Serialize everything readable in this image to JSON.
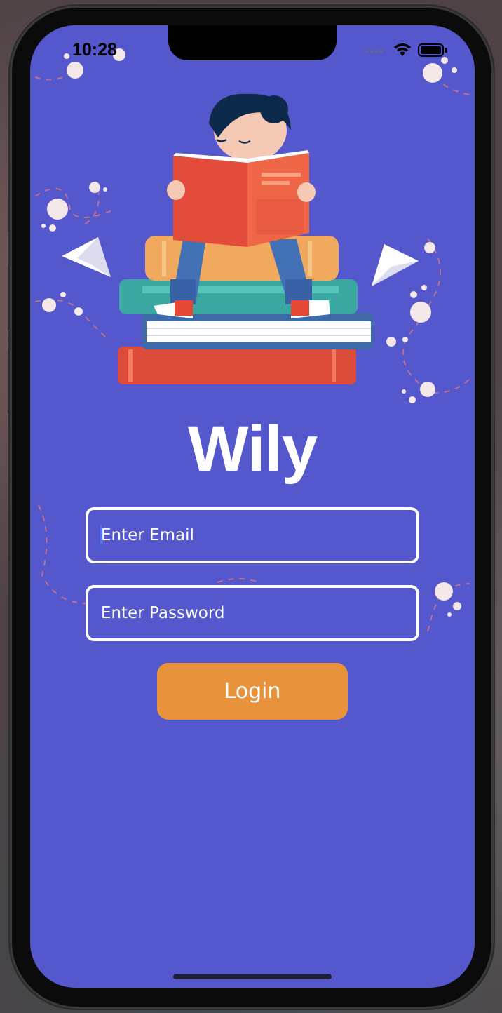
{
  "status_bar": {
    "time": "10:28",
    "wifi_icon": "wifi-icon",
    "battery_icon": "battery-icon"
  },
  "app": {
    "brand": "Wily",
    "illustration": "child-reading-on-books-illustration"
  },
  "form": {
    "email_placeholder": "Enter Email",
    "email_value": "",
    "password_placeholder": "Enter Password",
    "password_value": "",
    "login_label": "Login"
  },
  "colors": {
    "background": "#5557cc",
    "button": "#e8923c",
    "field_border": "#ffffff",
    "text": "#ffffff"
  }
}
